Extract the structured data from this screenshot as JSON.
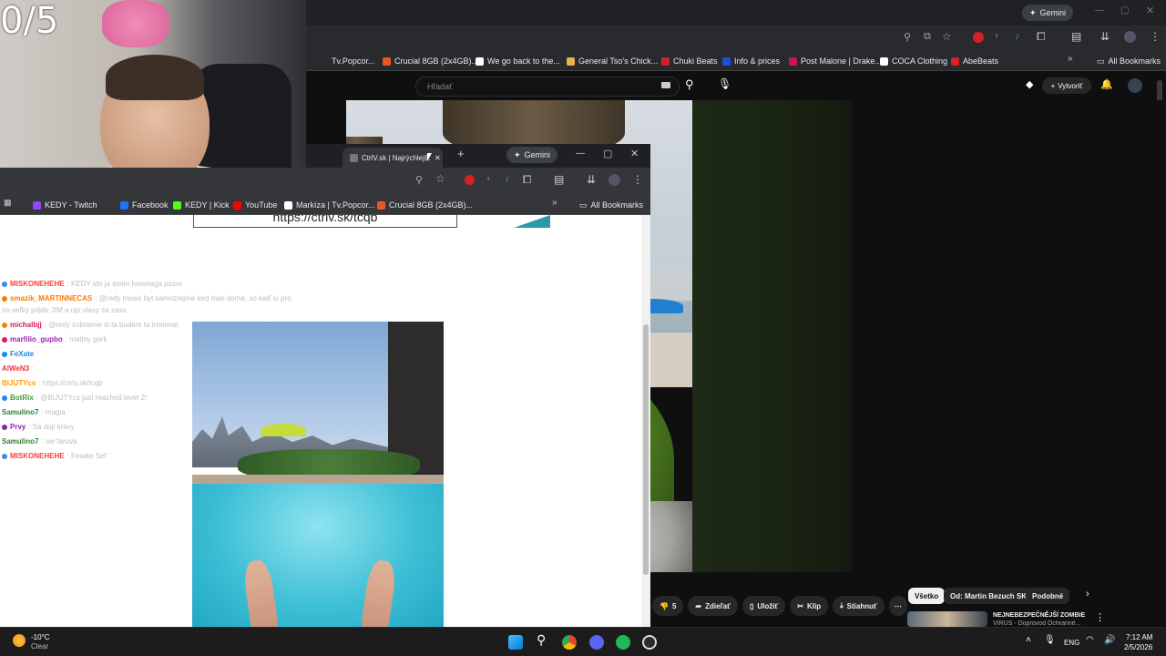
{
  "webcam": {
    "counter": "0/5"
  },
  "bg_browser": {
    "gemini_label": "Gemini",
    "bookmarks": [
      {
        "label": "Tv.Popcor...",
        "color": "#2b2b2b"
      },
      {
        "label": "Crucial 8GB (2x4GB)...",
        "color": "#e85a1b"
      },
      {
        "label": "We go back to the...",
        "color": "#ffffff"
      },
      {
        "label": "General Tso's Chick...",
        "color": "#e8b14a"
      },
      {
        "label": "Chuki Beats",
        "color": "#d81f26"
      },
      {
        "label": "Info & prices",
        "color": "#1a4fd8"
      },
      {
        "label": "Post Malone | Drake...",
        "color": "#c2185b"
      },
      {
        "label": "COCA Clothing",
        "color": "#ffffff"
      },
      {
        "label": "AbeBeats",
        "color": "#d81f26"
      }
    ],
    "all_bookmarks": "All Bookmarks",
    "yt": {
      "search_placeholder": "Hľadať",
      "create_label": "Vytvoriť",
      "actions": {
        "dislike_count": "5",
        "share": "Zdieľať",
        "save": "Uložiť",
        "clip": "Klip",
        "download": "Stiahnuť"
      },
      "chips": [
        "Všetko",
        "Od: Martin Bezuch SK",
        "Podobné"
      ],
      "rec_title": "NEJNEBEZPEČNĚJŠÍ ZOMBIE",
      "rec_sub": "VIRUS - Doprovod Ochranné..."
    }
  },
  "fg_browser": {
    "tab_title": "CtrlV.sk | Najrýchlejš...",
    "gemini_label": "Gemini",
    "bookmarks": [
      {
        "label": "KEDY - Twitch",
        "color": "#9146ff"
      },
      {
        "label": "Facebook",
        "color": "#1877f2"
      },
      {
        "label": "KEDY | Kick",
        "color": "#53fc18"
      },
      {
        "label": "YouTube",
        "color": "#ff0000"
      },
      {
        "label": "Markíza | Tv.Popcor...",
        "color": "#ffffff"
      },
      {
        "label": "Crucial 8GB (2x4GB)...",
        "color": "#e85a1b"
      }
    ],
    "all_bookmarks": "All Bookmarks",
    "url_text": "https://ctrlv.sk/tcqb"
  },
  "chat": [
    {
      "user": "MISKONEHEHE",
      "color": "#ff3b3b",
      "msg": ": KEDY ido ja smim hrovnaga pozor"
    },
    {
      "user": "smazik_MARTINNECAS",
      "color": "#ff7a00",
      "msg": ": @redy musis byt samozrejme ked mas doma, so keď sí pro"
    },
    {
      "user": "",
      "color": "#bdbdbd",
      "msg": "no veľký prijde JIM a ojo vlasy za zasu"
    },
    {
      "user": "michalbjj",
      "color": "#d81b60",
      "msg": ": @redy zobrieme si ta budem ta trenovat"
    },
    {
      "user": "marfilio_gupbo",
      "color": "#9c27b0",
      "msg": ": matloy gerk"
    },
    {
      "user": "FeXate",
      "color": "#1e88e5",
      "msg": ":"
    },
    {
      "user": "AlWeN3",
      "color": "#e53935",
      "msg": ":"
    },
    {
      "user": "BIJUTYcs",
      "color": "#ff9800",
      "msg": ": https://ctrlv.sk/tcqb"
    },
    {
      "user": "BotRix",
      "color": "#43a047",
      "msg": ": @BIJUTYcs just reached level 2!"
    },
    {
      "user": "Samulino7",
      "color": "#2e7d32",
      "msg": ": magia"
    },
    {
      "user": "Prvy",
      "color": "#8e24aa",
      "msg": ": Sa doji kravy"
    },
    {
      "user": "Samulino7",
      "color": "#2e7d32",
      "msg": ": sie farova"
    },
    {
      "user": "MISKONEHEHE",
      "color": "#ff3b3b",
      "msg": ": Fexate Sef"
    }
  ],
  "taskbar": {
    "weather_temp": "-10°C",
    "weather_desc": "Clear",
    "lang": "ENG",
    "time": "7:12 AM",
    "date": "2/5/2026"
  }
}
